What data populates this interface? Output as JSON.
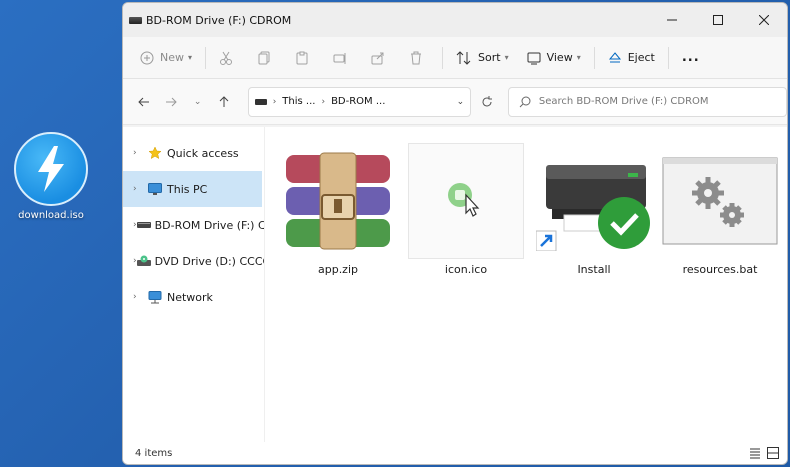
{
  "desktop": {
    "icon_label": "download.iso"
  },
  "window": {
    "title": "BD-ROM Drive (F:) CDROM"
  },
  "toolbar": {
    "new_label": "New",
    "sort_label": "Sort",
    "view_label": "View",
    "eject_label": "Eject",
    "more_label": "..."
  },
  "address": {
    "crumbs": [
      "This ...",
      "BD-ROM ..."
    ],
    "search_placeholder": "Search BD-ROM Drive (F:) CDROM"
  },
  "nav": {
    "items": [
      {
        "label": "Quick access",
        "icon": "star-icon"
      },
      {
        "label": "This PC",
        "icon": "monitor-icon"
      },
      {
        "label": "BD-ROM Drive (F:) C",
        "icon": "drive-icon"
      },
      {
        "label": "DVD Drive (D:) CCCC",
        "icon": "dvd-icon"
      },
      {
        "label": "Network",
        "icon": "network-icon"
      }
    ]
  },
  "files": [
    {
      "name": "app.zip",
      "icon": "winrar-archive-icon"
    },
    {
      "name": "icon.ico",
      "icon": "ico-file-icon"
    },
    {
      "name": "Install",
      "icon": "installer-shortcut-icon"
    },
    {
      "name": "resources.bat",
      "icon": "batch-file-icon"
    }
  ],
  "status": {
    "count": "4 items"
  },
  "colors": {
    "accent": "#0067c0",
    "selected": "#cce4f7",
    "desktop": "#2461b0"
  }
}
